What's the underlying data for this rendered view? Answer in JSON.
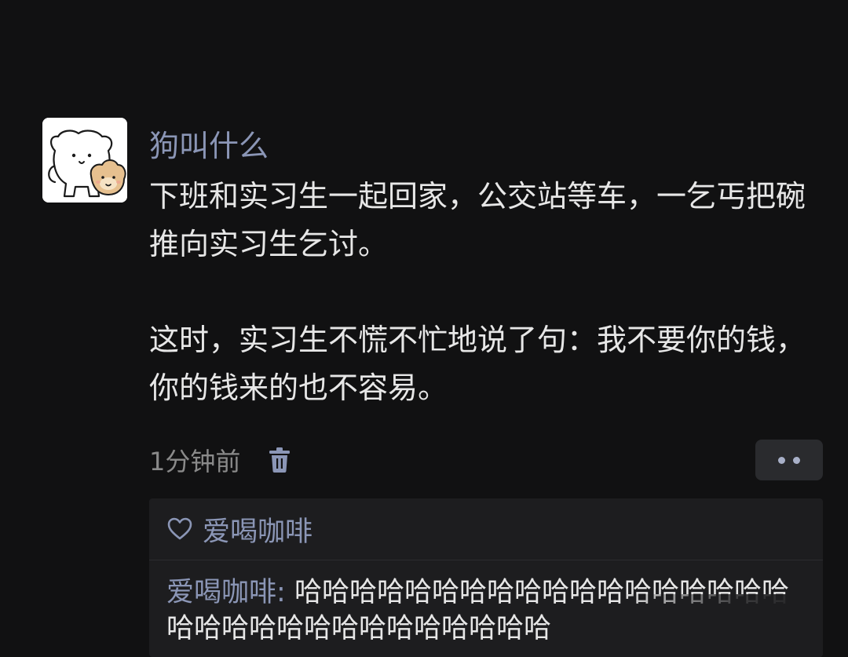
{
  "post": {
    "author": "狗叫什么",
    "paragraphs": [
      "下班和实习生一起回家，公交站等车，一乞丐把碗推向实习生乞讨。",
      "这时，实习生不慌不忙地说了句：我不要你的钱，你的钱来的也不容易。"
    ],
    "timestamp": "1分钟前"
  },
  "icons": {
    "delete": "trash-icon",
    "more": "more-dots-icon",
    "like": "heart-icon",
    "avatar": "cartoon-dog-avatar"
  },
  "likes": {
    "names": "爱喝咖啡"
  },
  "comments": [
    {
      "author": "爱喝咖啡",
      "separator": ": ",
      "text": "哈哈哈哈哈哈哈哈哈哈哈哈哈哈哈哈哈哈哈哈哈哈哈哈哈哈哈哈哈哈哈哈"
    }
  ],
  "colors": {
    "background": "#111112",
    "name_accent": "#8b96b6",
    "body_text": "#e7e7e7",
    "muted_text": "#8a8a8a",
    "comment_panel": "#1d1d1f"
  }
}
